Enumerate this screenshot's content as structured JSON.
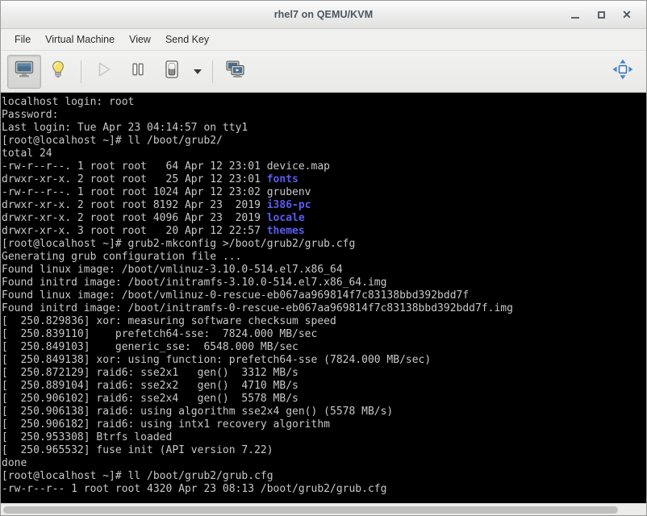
{
  "window": {
    "title": "rhel7 on QEMU/KVM",
    "controls": {
      "minimize": "minimize",
      "maximize": "maximize",
      "close": "close"
    }
  },
  "menubar": {
    "items": [
      {
        "label": "File"
      },
      {
        "label": "Virtual Machine"
      },
      {
        "label": "View"
      },
      {
        "label": "Send Key"
      }
    ]
  },
  "toolbar": {
    "buttons": [
      {
        "name": "console-view",
        "icon": "monitor-icon",
        "state": "active"
      },
      {
        "name": "details-view",
        "icon": "lightbulb-icon",
        "state": "normal"
      },
      {
        "name": "run",
        "icon": "play-icon",
        "state": "disabled"
      },
      {
        "name": "pause",
        "icon": "pause-icon",
        "state": "normal"
      },
      {
        "name": "shutdown",
        "icon": "power-icon",
        "state": "normal"
      },
      {
        "name": "shutdown-menu",
        "icon": "chevron-down-icon",
        "state": "normal"
      },
      {
        "name": "snapshots",
        "icon": "snapshot-icon",
        "state": "normal"
      },
      {
        "name": "fullscreen",
        "icon": "resize-arrows-icon",
        "state": "normal"
      }
    ]
  },
  "terminal": {
    "lines": [
      [
        {
          "t": "localhost login: root"
        }
      ],
      [
        {
          "t": "Password:"
        }
      ],
      [
        {
          "t": "Last login: Tue Apr 23 04:14:57 on tty1"
        }
      ],
      [
        {
          "t": "[root@localhost ~]# ll /boot/grub2/"
        }
      ],
      [
        {
          "t": "total 24"
        }
      ],
      [
        {
          "t": "-rw-r--r--. 1 root root   64 Apr 12 23:01 device.map"
        }
      ],
      [
        {
          "t": "drwxr-xr-x. 2 root root   25 Apr 12 23:01 "
        },
        {
          "t": "fonts",
          "c": "dir"
        }
      ],
      [
        {
          "t": "-rw-r--r--. 1 root root 1024 Apr 12 23:02 grubenv"
        }
      ],
      [
        {
          "t": "drwxr-xr-x. 2 root root 8192 Apr 23  2019 "
        },
        {
          "t": "i386-pc",
          "c": "dir"
        }
      ],
      [
        {
          "t": "drwxr-xr-x. 2 root root 4096 Apr 23  2019 "
        },
        {
          "t": "locale",
          "c": "dir"
        }
      ],
      [
        {
          "t": "drwxr-xr-x. 3 root root   20 Apr 12 22:57 "
        },
        {
          "t": "themes",
          "c": "dir"
        }
      ],
      [
        {
          "t": "[root@localhost ~]# grub2-mkconfig >/boot/grub2/grub.cfg"
        }
      ],
      [
        {
          "t": "Generating grub configuration file ..."
        }
      ],
      [
        {
          "t": "Found linux image: /boot/vmlinuz-3.10.0-514.el7.x86_64"
        }
      ],
      [
        {
          "t": "Found initrd image: /boot/initramfs-3.10.0-514.el7.x86_64.img"
        }
      ],
      [
        {
          "t": "Found linux image: /boot/vmlinuz-0-rescue-eb067aa969814f7c83138bbd392bdd7f"
        }
      ],
      [
        {
          "t": "Found initrd image: /boot/initramfs-0-rescue-eb067aa969814f7c83138bbd392bdd7f.img"
        }
      ],
      [
        {
          "t": "[  250.829836] xor: measuring software checksum speed"
        }
      ],
      [
        {
          "t": "[  250.839110]    prefetch64-sse:  7824.000 MB/sec"
        }
      ],
      [
        {
          "t": "[  250.849103]    generic_sse:  6548.000 MB/sec"
        }
      ],
      [
        {
          "t": "[  250.849138] xor: using function: prefetch64-sse (7824.000 MB/sec)"
        }
      ],
      [
        {
          "t": "[  250.872129] raid6: sse2x1   gen()  3312 MB/s"
        }
      ],
      [
        {
          "t": "[  250.889104] raid6: sse2x2   gen()  4710 MB/s"
        }
      ],
      [
        {
          "t": "[  250.906102] raid6: sse2x4   gen()  5578 MB/s"
        }
      ],
      [
        {
          "t": "[  250.906138] raid6: using algorithm sse2x4 gen() (5578 MB/s)"
        }
      ],
      [
        {
          "t": "[  250.906182] raid6: using intx1 recovery algorithm"
        }
      ],
      [
        {
          "t": "[  250.953308] Btrfs loaded"
        }
      ],
      [
        {
          "t": "[  250.965532] fuse init (API version 7.22)"
        }
      ],
      [
        {
          "t": "done"
        }
      ],
      [
        {
          "t": "[root@localhost ~]# ll /boot/grub2/grub.cfg"
        }
      ],
      [
        {
          "t": "-rw-r--r-- 1 root root 4320 Apr 23 08:13 /boot/grub2/grub.cfg"
        }
      ]
    ]
  },
  "scrollbar": {
    "name": "horizontal-scrollbar"
  },
  "colors": {
    "terminal_bg": "#000000",
    "terminal_fg": "#c8c8c8",
    "directory_blue": "#5b5bf0",
    "titlebar_text": "#4a5560"
  }
}
